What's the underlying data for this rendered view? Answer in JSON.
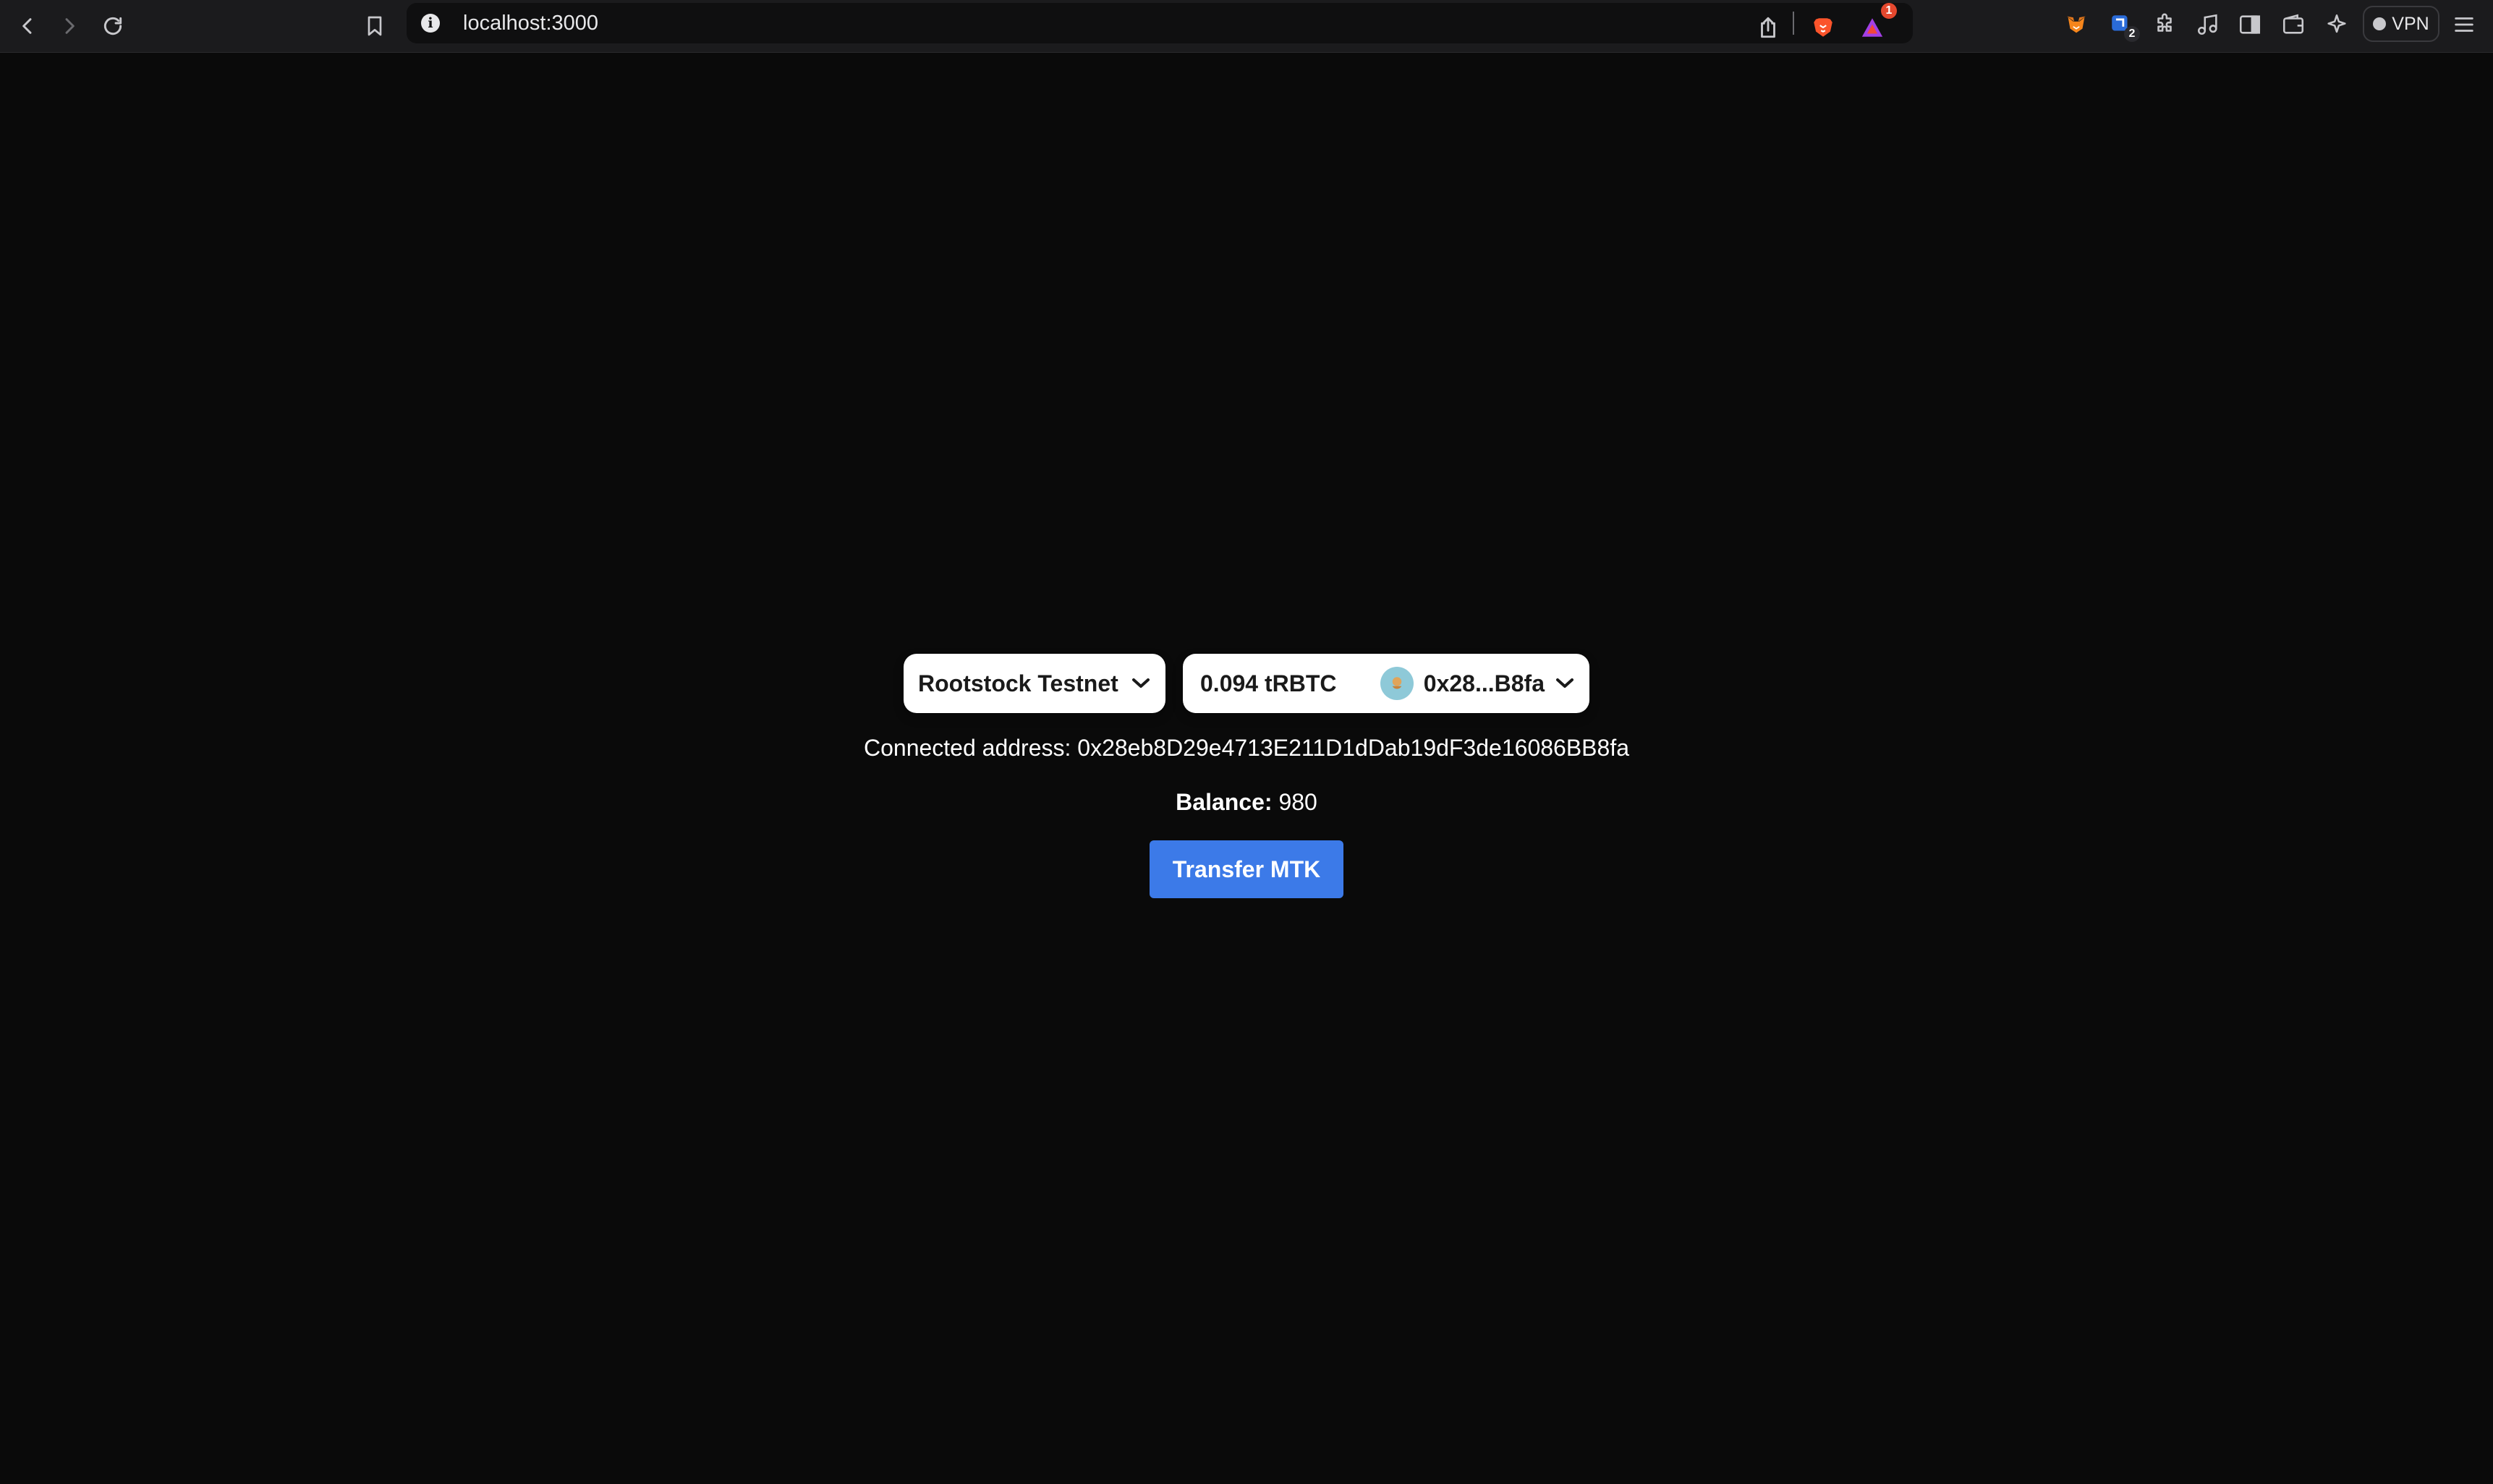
{
  "browser": {
    "url": "localhost:3000",
    "icons": {
      "back": "back-arrow-icon",
      "forward": "forward-arrow-icon",
      "reload": "reload-icon",
      "bookmark": "bookmark-icon",
      "site_info": "info-icon",
      "share": "share-icon",
      "brave_shields": "brave-lion-icon",
      "brave_rewards": "brave-rewards-icon",
      "metamask": "metamask-fox-icon",
      "extension_2": "extension-icon",
      "extensions": "puzzle-icon",
      "media": "music-note-icon",
      "sidebar": "sidebar-icon",
      "wallet": "wallet-icon",
      "leo": "leo-ai-icon",
      "menu": "hamburger-menu-icon"
    },
    "rewards_badge": "1",
    "extension_badge": "2",
    "vpn_label": "VPN",
    "colors": {
      "brave_orange": "#fb542b",
      "badge_red": "#e5482e",
      "extension_blue": "#2a6bd8"
    }
  },
  "wallet": {
    "network_label": "Rootstock Testnet",
    "balance_display": "0.094 tRBTC",
    "short_address": "0x28...B8fa"
  },
  "info": {
    "connected_label": "Connected address:",
    "connected_address": "0x28eb8D29e4713E211D1dDab19dF3de16086BB8fa",
    "balance_label": "Balance:",
    "balance_value": "980"
  },
  "actions": {
    "transfer_label": "Transfer MTK",
    "transfer_color": "#3c7ae8"
  }
}
